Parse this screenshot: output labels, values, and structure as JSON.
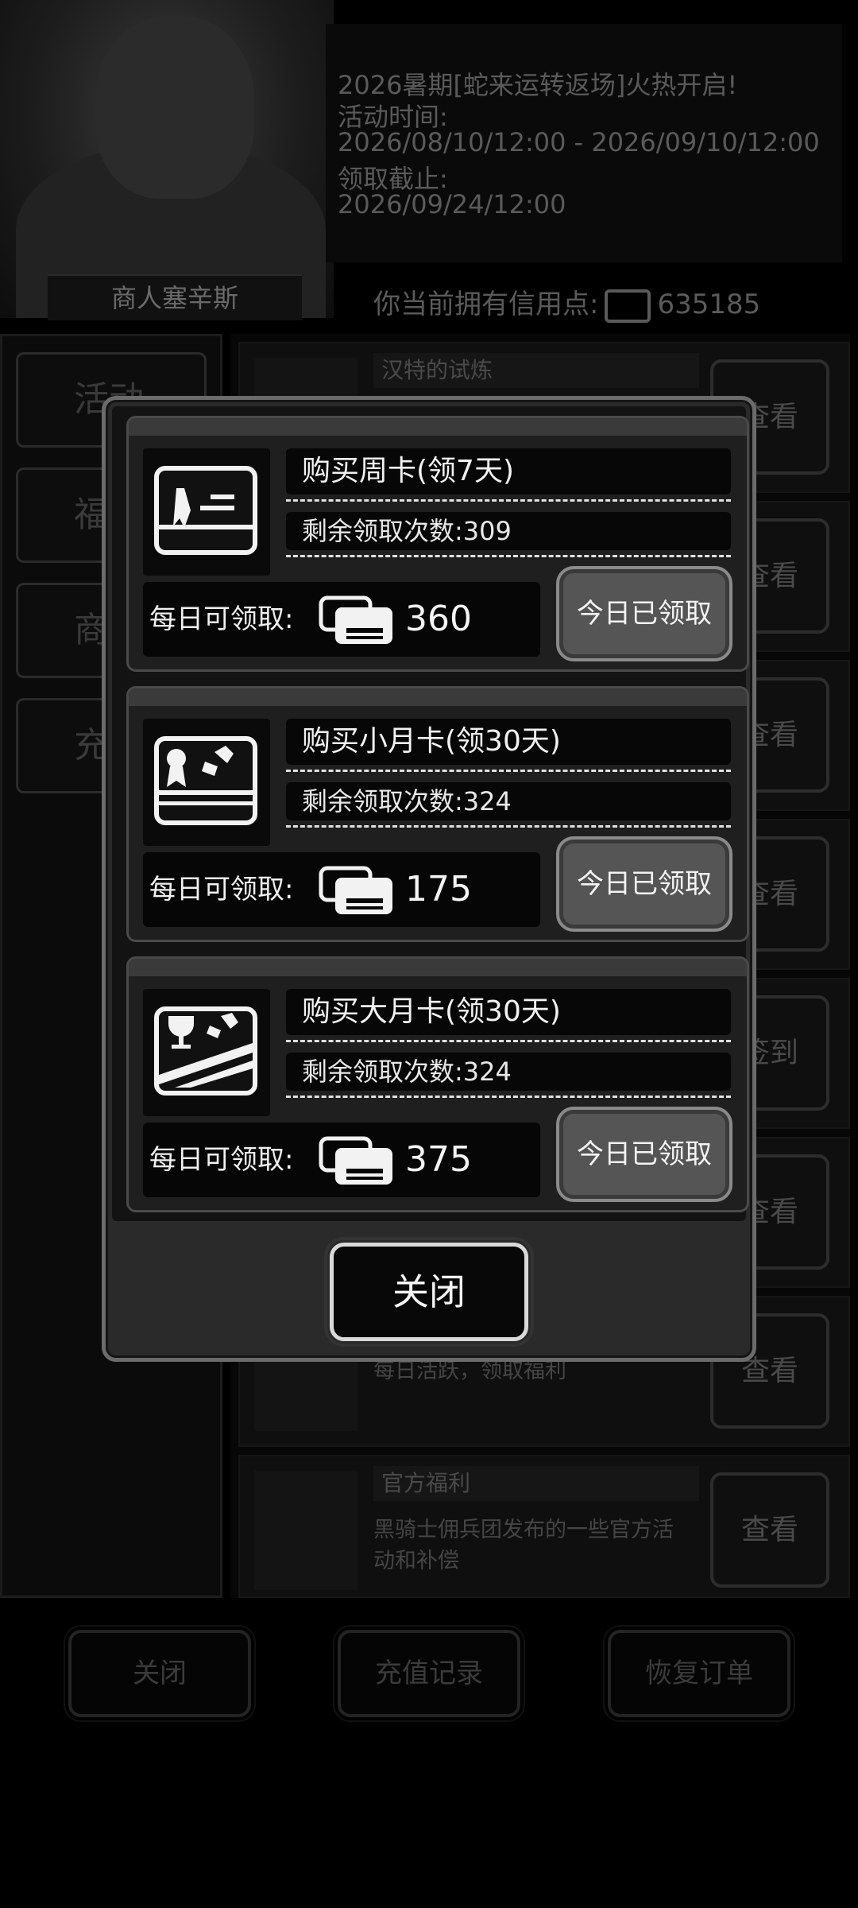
{
  "background": {
    "merchant_name": "商人塞辛斯",
    "event": {
      "line1": "2026暑期[蛇来运转返场]火热开启!",
      "line2": "活动时间:",
      "line3": "2026/08/10/12:00 - 2026/09/10/12:00",
      "line4": "领取截止:",
      "line5": "2026/09/24/12:00"
    },
    "credits_label": "你当前拥有信用点:",
    "credits_value": "635185",
    "left_tabs": [
      "活动",
      "福",
      "商",
      "充"
    ],
    "rows": [
      {
        "title": "汉特的试炼",
        "desc": "",
        "button": "查看"
      },
      {
        "title": "",
        "desc": "",
        "button": "查看"
      },
      {
        "title": "",
        "desc": "",
        "button": "查看"
      },
      {
        "title": "",
        "desc": "",
        "button": "查看"
      },
      {
        "title": "",
        "desc": "",
        "button": "签到"
      },
      {
        "title": "",
        "desc": "",
        "button": "查看"
      },
      {
        "title": "",
        "desc": "每日活跃，领取福利",
        "button": "查看"
      },
      {
        "title": "官方福利",
        "desc": "黑骑士佣兵团发布的一些官方活动和补偿",
        "button": "查看"
      }
    ],
    "bottom_buttons": {
      "close": "关闭",
      "recharge_history": "充值记录",
      "restore_order": "恢复订单"
    }
  },
  "modal": {
    "cards": [
      {
        "title": "购买周卡(领7天)",
        "remaining": "剩余领取次数:309",
        "daily_label": "每日可领取:",
        "daily_value": "360",
        "button": "今日已领取",
        "icon": "ribbon-card-icon"
      },
      {
        "title": "购买小月卡(领30天)",
        "remaining": "剩余领取次数:324",
        "daily_label": "每日可领取:",
        "daily_value": "175",
        "button": "今日已领取",
        "icon": "medal-card-icon"
      },
      {
        "title": "购买大月卡(领30天)",
        "remaining": "剩余领取次数:324",
        "daily_label": "每日可领取:",
        "daily_value": "375",
        "button": "今日已领取",
        "icon": "trophy-card-icon"
      }
    ],
    "close_button": "关闭"
  },
  "colors": {
    "modal_bg": "#2a2a2a",
    "modal_border": "#6b6b6b",
    "claimed_button": "#555555",
    "text": "#f2f2f2"
  }
}
